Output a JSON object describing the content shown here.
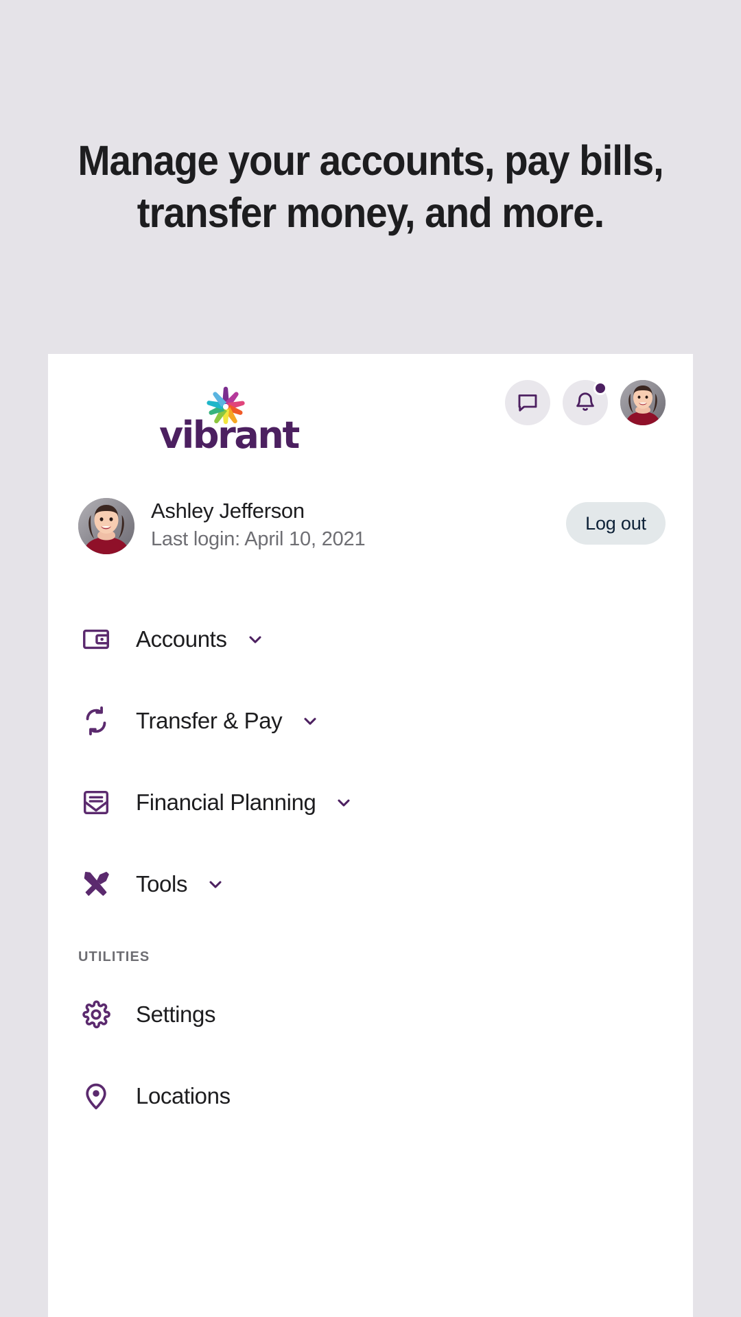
{
  "headline": {
    "line1": "Manage your accounts, pay bills,",
    "line2": "transfer money, and more."
  },
  "colors": {
    "page_background": "#e5e3e8",
    "card_background": "#ffffff",
    "brand_purple": "#4c2060",
    "icon_purple": "#5b2a6e",
    "text_primary": "#1d1d1f",
    "text_muted": "#6e6e73",
    "logout_bg": "#e3e8ea",
    "logout_text": "#0d2137",
    "icon_circle_bg": "#e9e7ec",
    "badge": "#4c2060"
  },
  "brand": {
    "wordmark": "vibrant",
    "logo_icon_name": "vibrant-pinwheel-logo",
    "pinwheel_colors": [
      "#7b2d8e",
      "#b5399a",
      "#e0457b",
      "#f05a28",
      "#f5a623",
      "#f2e63d",
      "#8cc63f",
      "#36b37e",
      "#1fb6c9",
      "#4a90d9"
    ]
  },
  "topbar": {
    "icons": [
      {
        "name": "messages-icon",
        "glyph": "chat-bubble",
        "has_badge": false
      },
      {
        "name": "notifications-icon",
        "glyph": "bell",
        "has_badge": true
      },
      {
        "name": "account-avatar",
        "glyph": "avatar",
        "has_badge": false
      }
    ]
  },
  "user": {
    "avatar_name": "user-avatar",
    "name": "Ashley Jefferson",
    "last_login": "Last login: April 10, 2021",
    "logout_label": "Log out"
  },
  "nav": {
    "items": [
      {
        "label": "Accounts",
        "icon": "wallet-icon",
        "has_chevron": true
      },
      {
        "label": "Transfer & Pay",
        "icon": "transfer-sync-icon",
        "has_chevron": true
      },
      {
        "label": "Financial Planning",
        "icon": "envelope-document-icon",
        "has_chevron": true
      },
      {
        "label": "Tools",
        "icon": "hammer-screwdriver-icon",
        "has_chevron": true
      }
    ],
    "utilities_label": "UTILITIES",
    "utilities": [
      {
        "label": "Settings",
        "icon": "gear-icon",
        "has_chevron": false
      },
      {
        "label": "Locations",
        "icon": "map-pin-icon",
        "has_chevron": false
      }
    ]
  }
}
